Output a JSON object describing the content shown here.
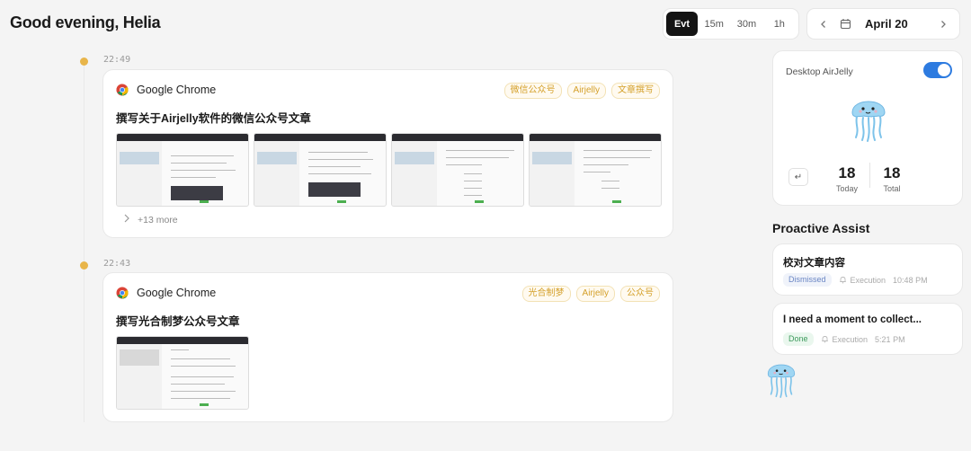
{
  "header": {
    "greeting": "Good evening, Helia",
    "intervals": [
      "Evt",
      "15m",
      "30m",
      "1h"
    ],
    "active_interval": "Evt",
    "date": "April 20"
  },
  "timeline": [
    {
      "time": "22:49",
      "app": "Google Chrome",
      "tags": [
        "微信公众号",
        "Airjelly",
        "文章撰写"
      ],
      "title": "撰写关于Airjelly软件的微信公众号文章",
      "screenshots": 4,
      "more_label": "+13 more"
    },
    {
      "time": "22:43",
      "app": "Google Chrome",
      "tags": [
        "光合制梦",
        "Airjelly",
        "公众号"
      ],
      "title": "撰写光合制梦公众号文章",
      "screenshots": 1
    }
  ],
  "assistant": {
    "label": "Desktop AirJelly",
    "enabled": true,
    "today_count": "18",
    "today_label": "Today",
    "total_count": "18",
    "total_label": "Total",
    "enter_glyph": "↵"
  },
  "proactive": {
    "title": "Proactive Assist",
    "items": [
      {
        "title": "校对文章内容",
        "status": "Dismissed",
        "kind": "Execution",
        "time": "10:48 PM"
      },
      {
        "title": "I need a moment to collect...",
        "status": "Done",
        "kind": "Execution",
        "time": "5:21 PM"
      }
    ]
  },
  "colors": {
    "accent": "#2d7be0",
    "timeline_dot": "#e8b54a",
    "tag_text": "#d4a02a",
    "jelly": "#8fcdf0"
  },
  "icons": [
    "chrome-icon",
    "calendar-icon",
    "chevron-left-icon",
    "chevron-right-icon",
    "bell-icon",
    "jellyfish-icon"
  ]
}
